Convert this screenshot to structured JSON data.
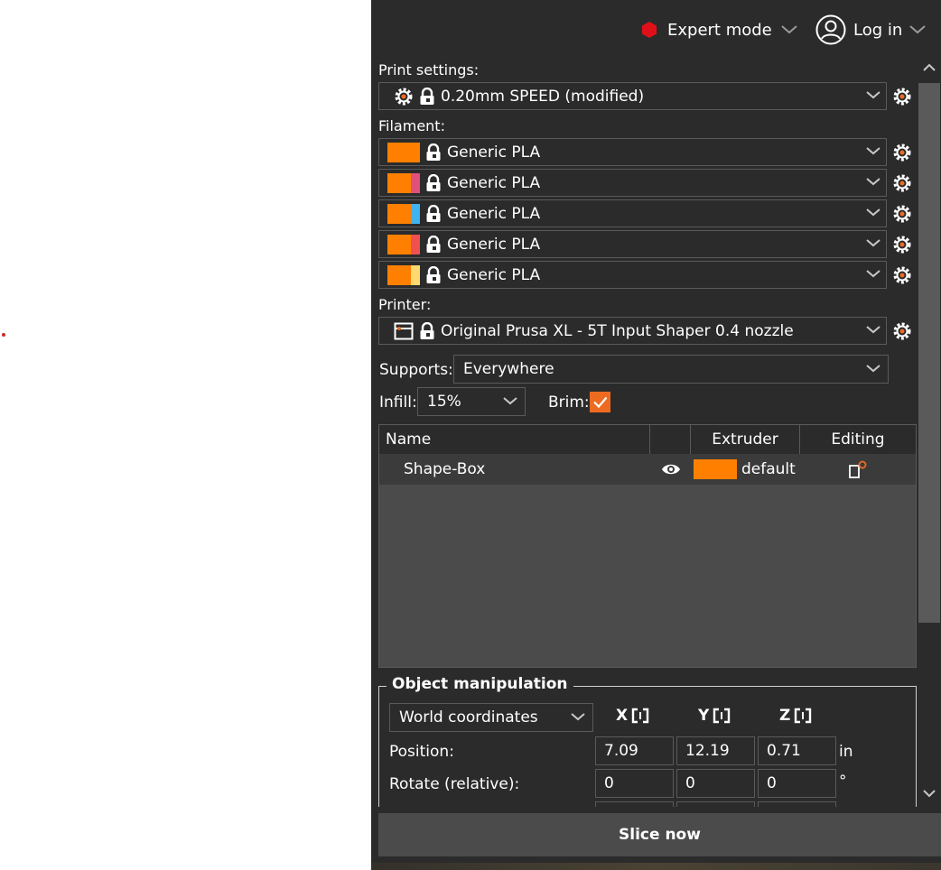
{
  "topbar": {
    "mode_label": "Expert mode",
    "login_label": "Log in"
  },
  "print_settings": {
    "label": "Print settings:",
    "value": "0.20mm SPEED (modified)"
  },
  "filament": {
    "label": "Filament:",
    "items": [
      {
        "name": "Generic PLA",
        "color": "#ff8000",
        "accent": "#ff8000"
      },
      {
        "name": "Generic PLA",
        "color": "#ff8000",
        "accent": "#e0507a"
      },
      {
        "name": "Generic PLA",
        "color": "#ff8000",
        "accent": "#3fb4f0"
      },
      {
        "name": "Generic PLA",
        "color": "#ff8000",
        "accent": "#f05050"
      },
      {
        "name": "Generic PLA",
        "color": "#ff8000",
        "accent": "#ffd870"
      }
    ]
  },
  "printer": {
    "label": "Printer:",
    "value": "Original Prusa XL - 5T Input Shaper 0.4 nozzle"
  },
  "supports": {
    "label": "Supports:",
    "value": "Everywhere"
  },
  "infill": {
    "label": "Infill:",
    "value": "15%"
  },
  "brim": {
    "label": "Brim:",
    "checked": true
  },
  "object_list": {
    "headers": {
      "name": "Name",
      "extruder": "Extruder",
      "editing": "Editing"
    },
    "rows": [
      {
        "name": "Shape-Box",
        "extruder": "default",
        "extruder_color": "#ff8000"
      }
    ]
  },
  "object_manipulation": {
    "title": "Object manipulation",
    "coordinates": "World coordinates",
    "axes": [
      "X",
      "Y",
      "Z"
    ],
    "position": {
      "label": "Position:",
      "x": "7.09",
      "y": "12.19",
      "z": "0.71",
      "unit": "in"
    },
    "rotate": {
      "label": "Rotate (relative):",
      "x": "0",
      "y": "0",
      "z": "0",
      "unit": "°"
    }
  },
  "slice_button": "Slice now",
  "colors": {
    "accent": "#ed6b21",
    "mode_indicator": "#e0101a",
    "background": "#2b2b2b"
  }
}
